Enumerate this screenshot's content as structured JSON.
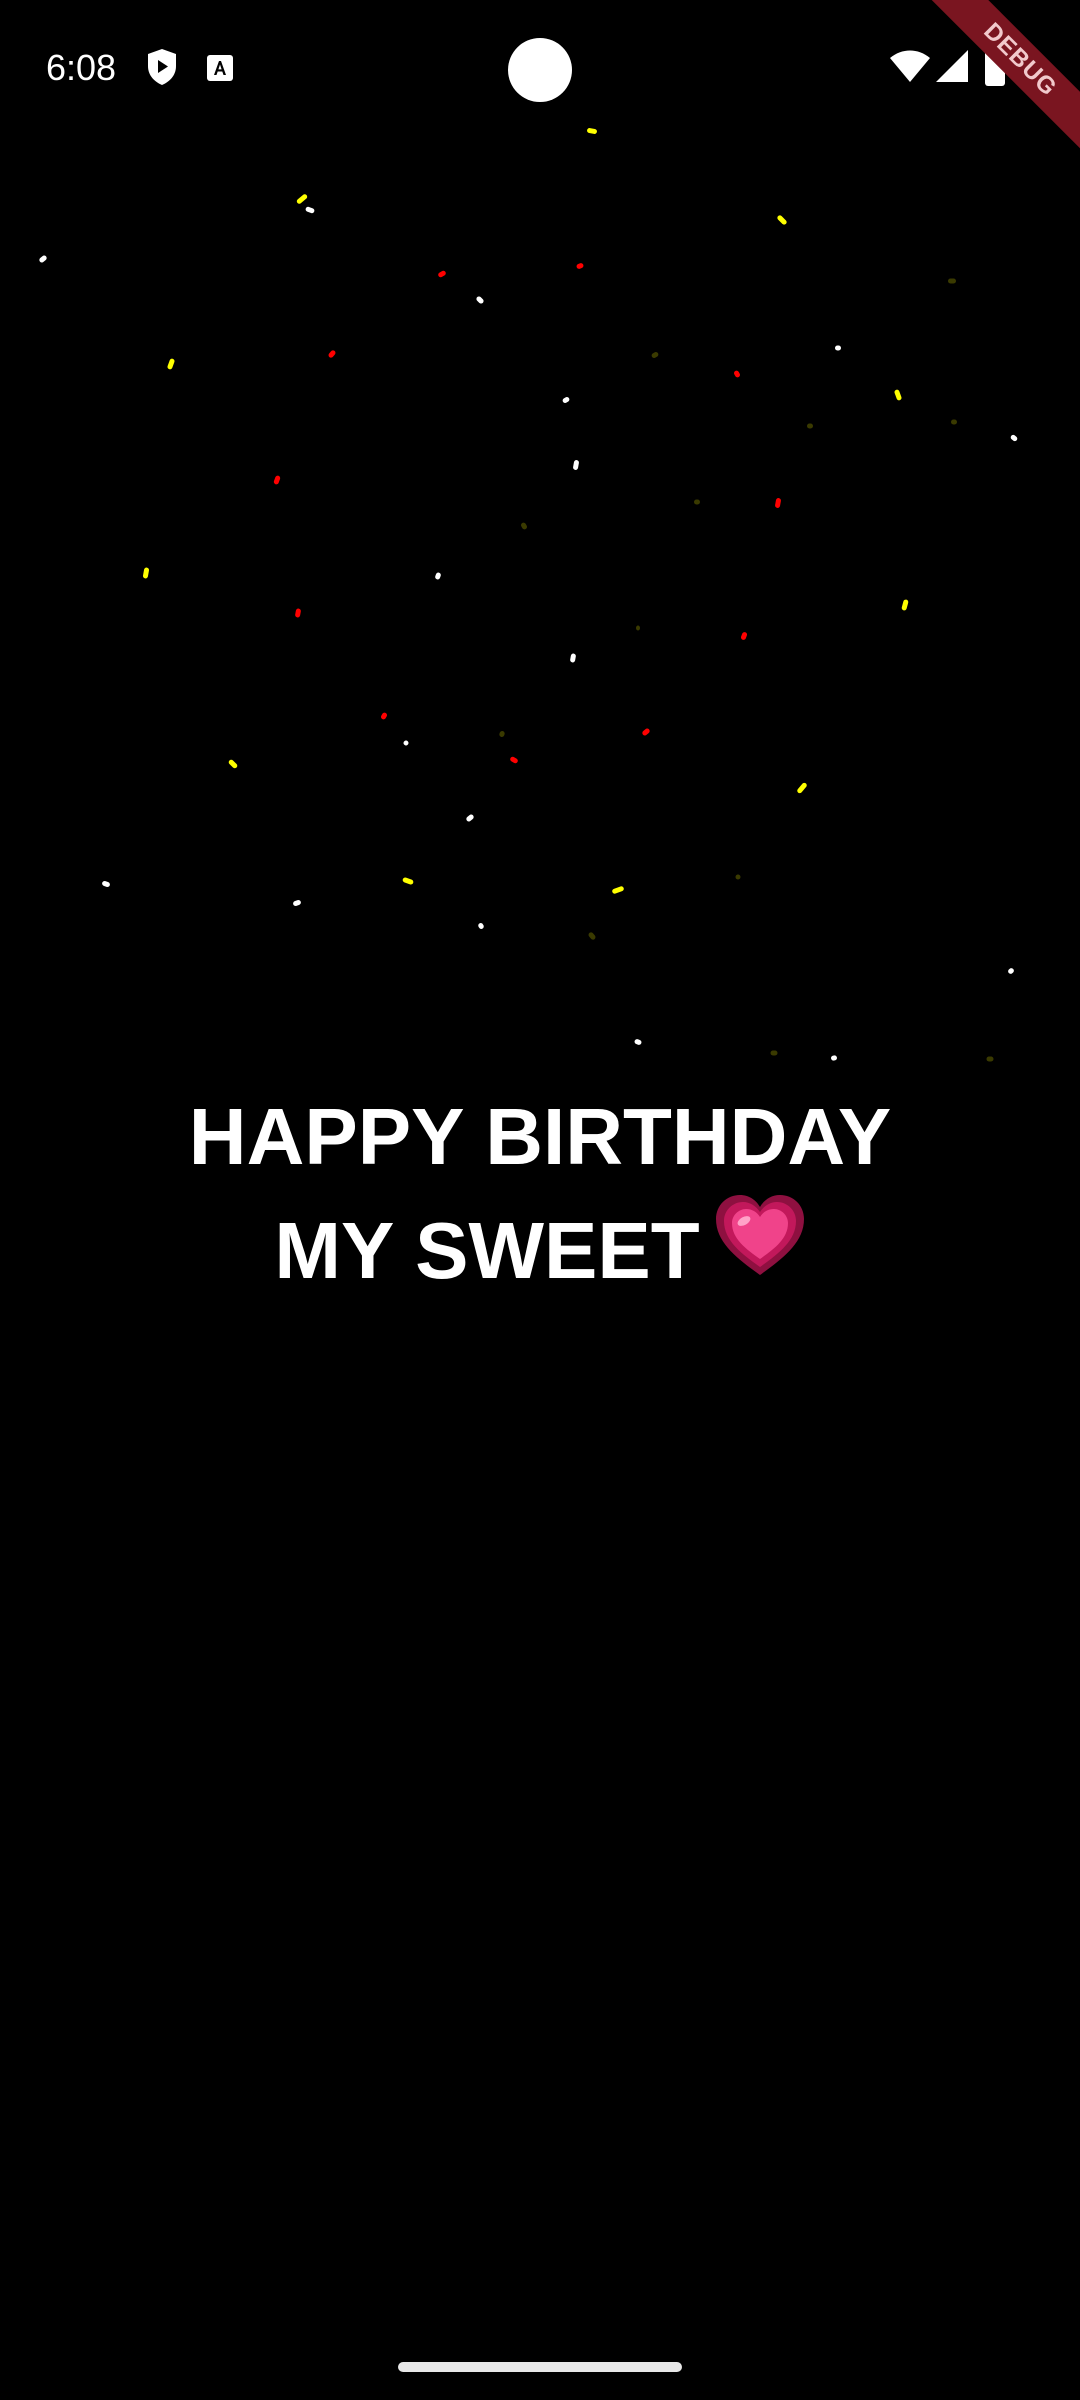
{
  "status_bar": {
    "time": "6:08",
    "left_icons": [
      "shield-play-icon",
      "a11y-text-icon"
    ],
    "right_icons": [
      "wifi-icon",
      "signal-icon",
      "battery-icon"
    ]
  },
  "debug_banner": {
    "label": "DEBUG",
    "color": "#7a1520"
  },
  "message": {
    "line1": "HAPPY BIRTHDAY",
    "line2": "MY SWEET",
    "emoji_icon": "growing-heart-icon"
  },
  "colors": {
    "background": "#000000",
    "text": "#ffffff",
    "confetti": [
      "#ffff00",
      "#ff0000",
      "#ffffff",
      "#3a3a00"
    ]
  }
}
